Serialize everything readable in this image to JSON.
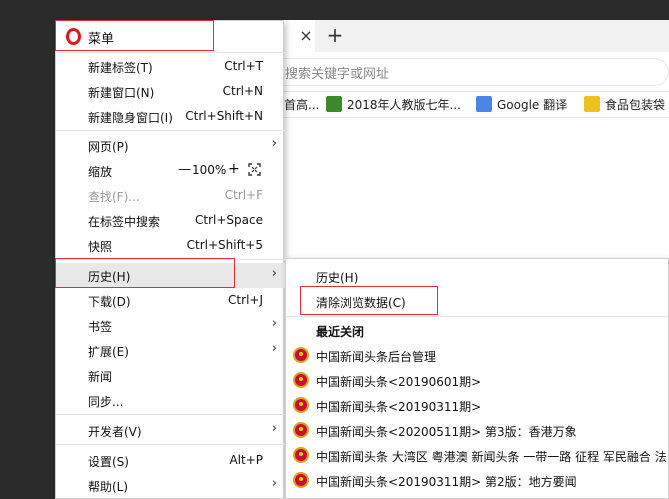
{
  "browser": {
    "tab_close": "×",
    "tab_new": "+",
    "address_placeholder": "搜索关键字或网址",
    "bookmarks": [
      {
        "label": "首高...",
        "icon": "page-icon"
      },
      {
        "label": "2018年人教版七年...",
        "icon": "green-site-icon"
      },
      {
        "label": "Google 翻译",
        "icon": "google-translate-icon"
      },
      {
        "label": "食品包装袋",
        "icon": "site-icon"
      }
    ]
  },
  "menu": {
    "title": "菜单",
    "icon": "opera-logo",
    "items": [
      {
        "label": "新建标签(T)",
        "shortcut": "Ctrl+T"
      },
      {
        "label": "新建窗口(N)",
        "shortcut": "Ctrl+N"
      },
      {
        "label": "新建隐身窗口(I)",
        "shortcut": "Ctrl+Shift+N"
      },
      {
        "label": "网页(P)",
        "shortcut": ""
      },
      {
        "label": "缩放",
        "shortcut": ""
      },
      {
        "label": "查找(F)...",
        "shortcut": "Ctrl+F"
      },
      {
        "label": "在标签中搜索",
        "shortcut": "Ctrl+Space"
      },
      {
        "label": "快照",
        "shortcut": "Ctrl+Shift+5"
      },
      {
        "label": "历史(H)",
        "shortcut": ""
      },
      {
        "label": "下载(D)",
        "shortcut": "Ctrl+J"
      },
      {
        "label": "书签",
        "shortcut": ""
      },
      {
        "label": "扩展(E)",
        "shortcut": ""
      },
      {
        "label": "新闻",
        "shortcut": ""
      },
      {
        "label": "同步...",
        "shortcut": ""
      },
      {
        "label": "开发者(V)",
        "shortcut": ""
      },
      {
        "label": "设置(S)",
        "shortcut": "Alt+P"
      },
      {
        "label": "帮助(L)",
        "shortcut": ""
      }
    ],
    "zoom": {
      "minus": "—",
      "value": "100%",
      "plus": "+",
      "icon": "fullscreen-icon"
    },
    "arrow": "›"
  },
  "history_submenu": {
    "items": [
      {
        "label": "历史(H)"
      },
      {
        "label": "清除浏览数据(C)"
      }
    ],
    "recent_heading": "最近关闭",
    "recent": [
      "中国新闻头条后台管理",
      "中国新闻头条<20190601期>",
      "中国新闻头条<20190311期>",
      "中国新闻头条<20200511期> 第3版：香港万象",
      "中国新闻头条 大湾区 粤港澳 新闻头条 一带一路 征程 军民融合 法",
      "中国新闻头条<20190311期> 第2版：地方要闻"
    ]
  },
  "colors": {
    "highlight_border": "#e0303a",
    "opera_red": "#e0141e",
    "disabled_text": "#9a9a9a"
  }
}
